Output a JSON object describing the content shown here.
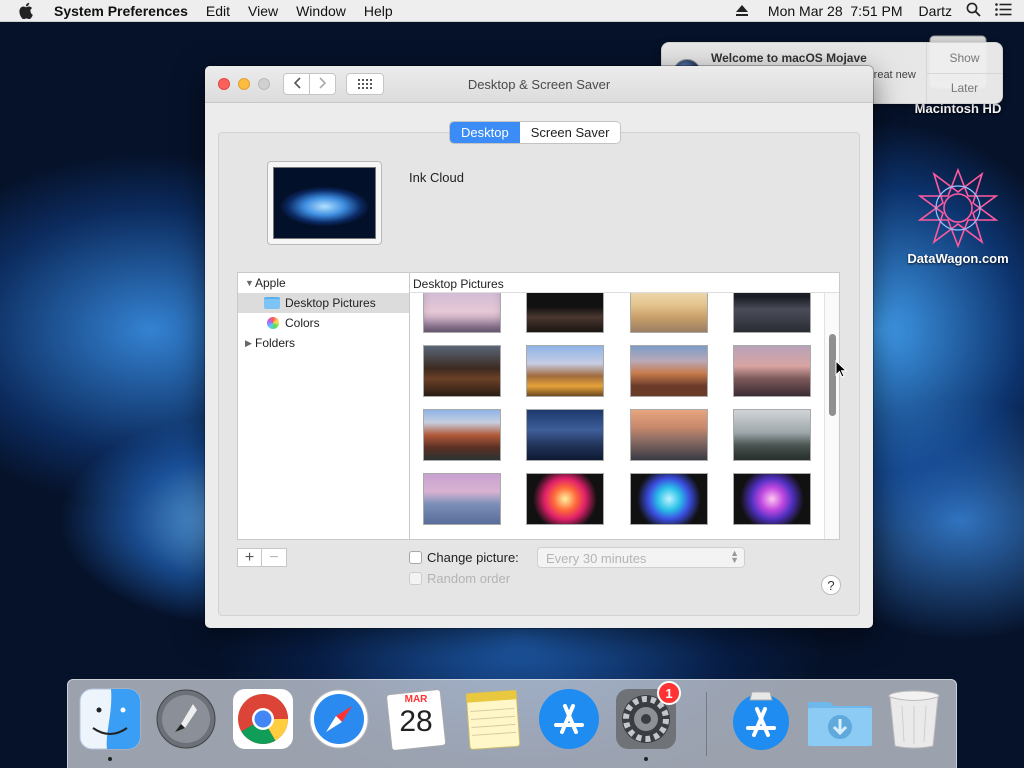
{
  "menubar": {
    "app_name": "System Preferences",
    "menus": [
      "Edit",
      "View",
      "Window",
      "Help"
    ],
    "clock": "Mon Mar 28  7:51 PM",
    "user": "Dartz"
  },
  "desktop": {
    "icons": [
      {
        "label": "Macintosh HD",
        "icon": "hard-drive-icon"
      },
      {
        "label": "DataWagon.com",
        "icon": "datawagon-logo-icon"
      }
    ]
  },
  "notification": {
    "title": "Welcome to macOS Mojave",
    "text": "Take a quick tour to learn about great new features.",
    "actions": [
      "Show",
      "Later"
    ]
  },
  "window": {
    "title": "Desktop & Screen Saver",
    "tabs": [
      {
        "label": "Desktop",
        "active": true
      },
      {
        "label": "Screen Saver",
        "active": false
      }
    ],
    "wallpaper_name": "Ink Cloud",
    "sidebar": {
      "items": [
        {
          "label": "Apple",
          "kind": "group",
          "expanded": true
        },
        {
          "label": "Desktop Pictures",
          "kind": "folder",
          "selected": true
        },
        {
          "label": "Colors",
          "kind": "colors"
        },
        {
          "label": "Folders",
          "kind": "group",
          "expanded": false
        }
      ]
    },
    "grid_header": "Desktop Pictures",
    "thumbnails": [
      "mojave-rock",
      "mojave-night-rocks",
      "mojave-dunes-day",
      "mojave-dune-dusk",
      "high-sierra-dark",
      "high-sierra",
      "sierra-peak",
      "sierra-dusk",
      "el-capitan-sunset",
      "yosemite-blue",
      "el-capitan-rock",
      "yosemite-fog",
      "yosemite-purple",
      "color-burst-red",
      "color-burst-blue",
      "color-burst-purple"
    ],
    "change_picture_label": "Change picture:",
    "change_picture_checked": false,
    "interval": "Every 30 minutes",
    "random_order_label": "Random order",
    "help_label": "?"
  },
  "dock": {
    "apps": [
      {
        "name": "Finder",
        "icon": "finder-icon",
        "running": true
      },
      {
        "name": "Launchpad",
        "icon": "launchpad-icon",
        "running": false
      },
      {
        "name": "Google Chrome",
        "icon": "chrome-icon",
        "running": false
      },
      {
        "name": "Safari",
        "icon": "safari-icon",
        "running": false
      },
      {
        "name": "Calendar",
        "icon": "calendar-icon",
        "running": false,
        "month": "MAR",
        "day": "28"
      },
      {
        "name": "Notes",
        "icon": "notes-icon",
        "running": false
      },
      {
        "name": "App Store",
        "icon": "app-store-icon",
        "running": false
      },
      {
        "name": "System Preferences",
        "icon": "system-preferences-icon",
        "running": true,
        "badge": "1"
      },
      {
        "name": "App Store Installer",
        "icon": "app-store-installer-icon",
        "running": false
      },
      {
        "name": "Downloads",
        "icon": "downloads-folder-icon",
        "running": false
      },
      {
        "name": "Trash",
        "icon": "trash-icon",
        "running": false
      }
    ]
  },
  "colors": {
    "accent": "#3b8cf6",
    "badge": "#ff3333",
    "close": "#fc605b",
    "minimize": "#fdbc40"
  }
}
